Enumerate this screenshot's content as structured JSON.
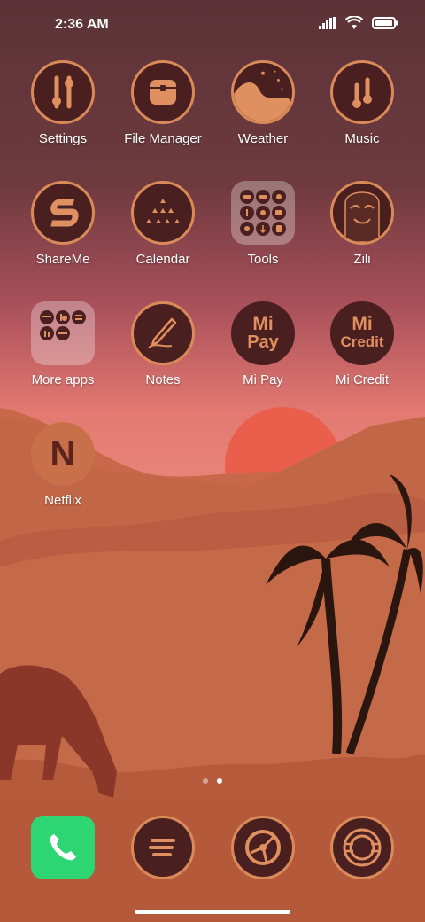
{
  "status_bar": {
    "time": "2:36 AM",
    "icons": [
      "signal-icon",
      "wifi-icon",
      "battery-icon"
    ]
  },
  "apps": [
    {
      "label": "Settings",
      "icon": "settings-icon"
    },
    {
      "label": "File Manager",
      "icon": "file-manager-icon"
    },
    {
      "label": "Weather",
      "icon": "weather-icon"
    },
    {
      "label": "Music",
      "icon": "music-icon"
    },
    {
      "label": "ShareMe",
      "icon": "shareme-icon"
    },
    {
      "label": "Calendar",
      "icon": "calendar-icon"
    },
    {
      "label": "Tools",
      "icon": "tools-folder-icon"
    },
    {
      "label": "Zili",
      "icon": "zili-icon"
    },
    {
      "label": "More apps",
      "icon": "more-apps-folder-icon"
    },
    {
      "label": "Notes",
      "icon": "notes-icon"
    },
    {
      "label": "Mi Pay",
      "icon": "mi-pay-icon",
      "logo_text": [
        "Mi",
        "Pay"
      ]
    },
    {
      "label": "Mi Credit",
      "icon": "mi-credit-icon",
      "logo_text": [
        "Mi",
        "Credit"
      ]
    },
    {
      "label": "Netflix",
      "icon": "netflix-icon",
      "logo_text": [
        "N"
      ]
    }
  ],
  "page_indicator": {
    "pages": 2,
    "active_page": 2
  },
  "dock": [
    {
      "icon": "phone-icon"
    },
    {
      "icon": "messaging-icon"
    },
    {
      "icon": "browser-icon"
    },
    {
      "icon": "camera-icon"
    }
  ],
  "colors": {
    "icon_background": "#4a1f1f",
    "icon_ring": "#d98a58",
    "icon_glyph": "#e09060",
    "phone_green": "#2ed573"
  }
}
